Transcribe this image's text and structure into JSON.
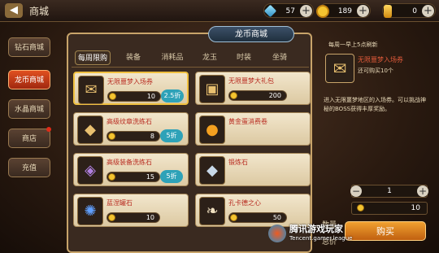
{
  "header": {
    "back_glyph": "◀",
    "title": "商城",
    "resources": [
      {
        "icon": "diamond-icon",
        "value": "57",
        "plus": "+"
      },
      {
        "icon": "coin-icon",
        "value": "189",
        "plus": "+"
      },
      {
        "icon": "gold-icon",
        "value": "0",
        "plus": "+"
      }
    ]
  },
  "sidebar": {
    "items": [
      {
        "label": "钻石商城",
        "active": false
      },
      {
        "label": "龙币商城",
        "active": true
      },
      {
        "label": "水晶商城",
        "active": false
      },
      {
        "label": "商店",
        "active": false,
        "badge": true
      },
      {
        "label": "充值",
        "active": false
      }
    ]
  },
  "shop": {
    "title": "龙币商城",
    "tabs": [
      "每周限购",
      "装备",
      "消耗品",
      "龙玉",
      "时装",
      "坐骑"
    ],
    "active_tab": 0,
    "items": [
      {
        "name": "无限噩梦入场券",
        "price": "10",
        "discount": "2.5折",
        "icon": "ticket-icon",
        "selected": true
      },
      {
        "name": "无限噩梦大礼包",
        "price": "200",
        "discount": "",
        "icon": "chest-icon",
        "selected": false
      },
      {
        "name": "高级纹章洗练石",
        "price": "8",
        "discount": "5折",
        "icon": "crystal-icon",
        "selected": false
      },
      {
        "name": "黄金蛋消费卷",
        "price": "",
        "discount": "",
        "icon": "golden-egg-icon",
        "selected": false
      },
      {
        "name": "高级装备洗练石",
        "price": "15",
        "discount": "5折",
        "icon": "stone-icon",
        "selected": false
      },
      {
        "name": "锻炼石",
        "price": "",
        "discount": "",
        "icon": "ore-icon",
        "selected": false
      },
      {
        "name": "蓝涅罐石",
        "price": "10",
        "discount": "",
        "icon": "gem-icon",
        "selected": false
      },
      {
        "name": "孔卡德之心",
        "price": "50",
        "discount": "",
        "icon": "feather-icon",
        "selected": false
      }
    ]
  },
  "detail": {
    "limit_hint": "每周一早上5点刷新",
    "name": "无限噩梦入场券",
    "owned": "还可购买10个",
    "description": "进入无限噩梦地区的入场券。可以挑战神秘的BOSS获得丰厚奖励。",
    "qty_label": "数量",
    "qty_value": "1",
    "minus": "−",
    "plus": "+",
    "total_label": "总价",
    "total_value": "10",
    "buy_label": "购买"
  },
  "watermark": {
    "text": "腾讯游戏玩家",
    "url": "Tencent.gamer.league"
  },
  "colors": {
    "accent": "#e05020",
    "discount": "#2ea2b8",
    "frame": "#c8a46a"
  }
}
